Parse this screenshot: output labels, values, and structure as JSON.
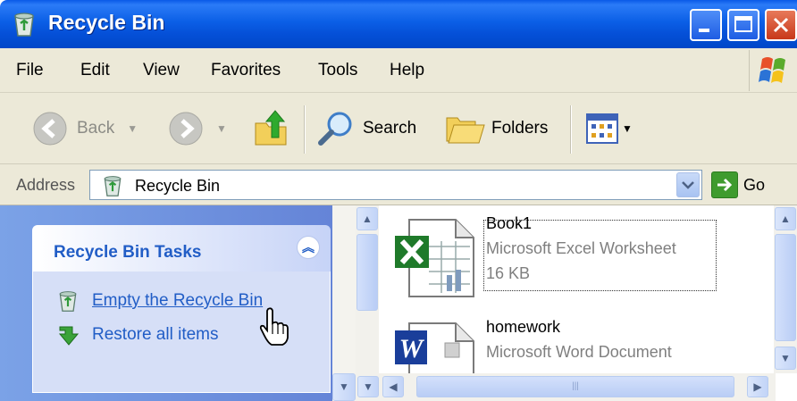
{
  "window": {
    "title": "Recycle Bin",
    "title_icon": "recycle-bin-icon"
  },
  "menu": [
    "File",
    "Edit",
    "View",
    "Favorites",
    "Tools",
    "Help"
  ],
  "toolbar": {
    "back_label": "Back",
    "search_label": "Search",
    "folders_label": "Folders"
  },
  "address": {
    "label": "Address",
    "value": "Recycle Bin",
    "go_label": "Go"
  },
  "tasks": {
    "header": "Recycle Bin Tasks",
    "items": [
      {
        "label": "Empty the Recycle Bin",
        "icon": "empty-recycle-bin-icon"
      },
      {
        "label": "Restore all items",
        "icon": "restore-arrow-icon"
      }
    ]
  },
  "files": [
    {
      "name": "Book1",
      "type": "Microsoft Excel Worksheet",
      "size": "16 KB",
      "icon": "excel-icon"
    },
    {
      "name": "homework",
      "type": "Microsoft Word Document",
      "icon": "word-icon"
    }
  ],
  "colors": {
    "titlebar_blue": "#0550d8",
    "task_link": "#215dc6",
    "panel_bg": "#ece9d8"
  }
}
